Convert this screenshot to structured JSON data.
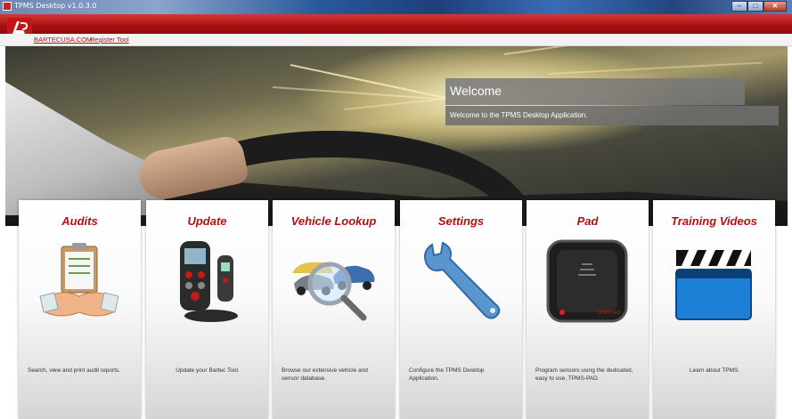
{
  "window": {
    "title": "TPMS Desktop v1.0.3.0"
  },
  "links": {
    "site": "BARTECUSA.COM",
    "register": "Register Tool"
  },
  "welcome": {
    "heading": "Welcome",
    "message": "Welcome to the TPMS Desktop Application."
  },
  "tiles": [
    {
      "title": "Audits",
      "description": "Search, view and print audit reports.",
      "icon": "handshake-clipboard-icon"
    },
    {
      "title": "Update",
      "description": "Update your Bartec Tool.",
      "icon": "tpms-tools-icon"
    },
    {
      "title": "Vehicle Lookup",
      "description": "Browse our extensive vehicle and sensor database.",
      "icon": "magnifier-cars-icon"
    },
    {
      "title": "Settings",
      "description": "Configure the TPMS Desktop Application.",
      "icon": "wrench-icon"
    },
    {
      "title": "Pad",
      "description": "Program sensors using the dedicated, easy to use, TPMS-PAD.",
      "icon": "tpms-pad-icon"
    },
    {
      "title": "Training Videos",
      "description": "Learn about TPMS.",
      "icon": "clapperboard-icon"
    }
  ],
  "colors": {
    "brand_red": "#b50f14",
    "header_red": "#a90f12"
  }
}
